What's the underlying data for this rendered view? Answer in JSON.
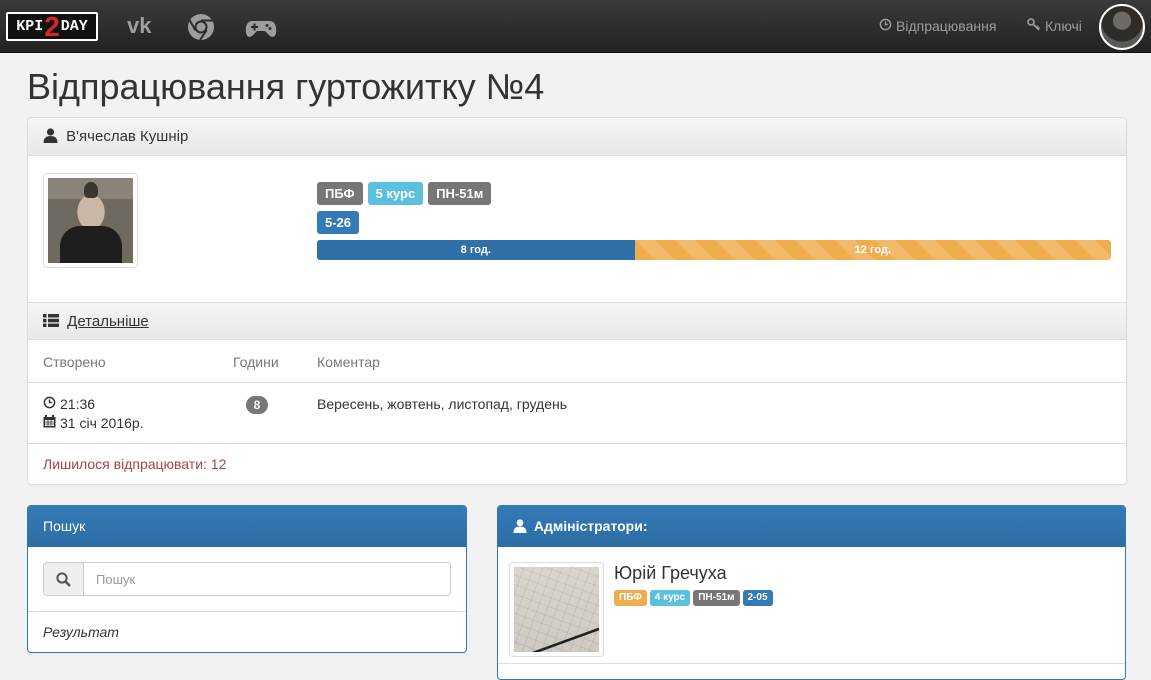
{
  "navbar": {
    "brand": {
      "left": "KPI",
      "middle": "2",
      "right": "DAY"
    },
    "links": [
      {
        "label": "Відпрацювання",
        "icon": "clock-icon"
      },
      {
        "label": "Ключі",
        "icon": "key-icon"
      }
    ]
  },
  "page": {
    "title": "Відпрацювання гуртожитку №4"
  },
  "profile": {
    "name": "В'ячеслав Кушнір",
    "labels": [
      "ПБФ",
      "5 курс",
      "ПН-51м"
    ],
    "room": "5-26",
    "progress": {
      "done": 8,
      "total": 20,
      "done_label": "8 год.",
      "remaining_label": "12 год."
    }
  },
  "details": {
    "title": "Детальніше",
    "columns": [
      "Створено",
      "Години",
      "Коментар"
    ],
    "rows": [
      {
        "time": "21:36",
        "date": "31 січ 2016р.",
        "hours": "8",
        "comment": "Вересень, жовтень, листопад, грудень"
      }
    ],
    "remaining": "Лишилося відпрацювати: 12"
  },
  "search": {
    "title": "Пошук",
    "placeholder": "Пошук",
    "result_label": "Результат"
  },
  "admins": {
    "title": "Адміністратори:",
    "items": [
      {
        "name": "Юрій Гречуха",
        "labels": [
          "ПБФ",
          "4 курс",
          "ПН-51м",
          "2-05"
        ]
      }
    ]
  },
  "colors": {
    "primary": "#337ab7",
    "warning": "#f0ad4e",
    "info": "#5bc0de",
    "default": "#777777",
    "danger": "#a94442"
  }
}
